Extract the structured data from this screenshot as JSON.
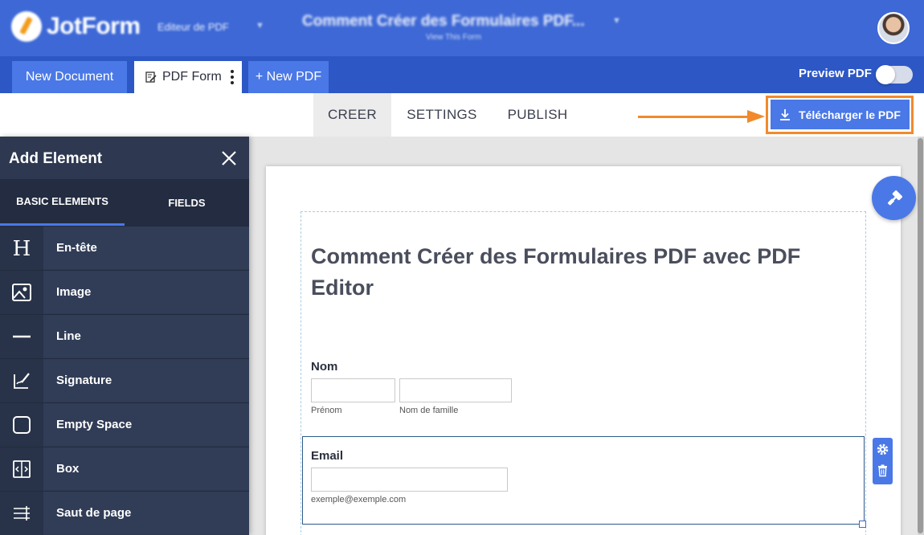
{
  "header": {
    "logo_text": "JotForm",
    "editor_name": "Editeur de PDF",
    "document_title": "Comment Créer des Formulaires PDF...",
    "document_subtitle": "View This Form"
  },
  "tabs": {
    "new_document": "New Document",
    "pdf_form": "PDF Form",
    "new_pdf": "+ New PDF",
    "preview_label": "Preview PDF",
    "preview_on": false
  },
  "subnav": {
    "creer": "CREER",
    "settings": "SETTINGS",
    "publish": "PUBLISH",
    "download": "Télécharger le PDF"
  },
  "panel": {
    "title": "Add Element",
    "tabs": [
      "BASIC ELEMENTS",
      "FIELDS"
    ],
    "items": [
      {
        "label": "En-tête",
        "icon": "heading-icon"
      },
      {
        "label": "Image",
        "icon": "image-icon"
      },
      {
        "label": "Line",
        "icon": "line-icon"
      },
      {
        "label": "Signature",
        "icon": "signature-icon"
      },
      {
        "label": "Empty Space",
        "icon": "empty-space-icon"
      },
      {
        "label": "Box",
        "icon": "box-icon"
      },
      {
        "label": "Saut de page",
        "icon": "page-break-icon"
      }
    ]
  },
  "form": {
    "heading": "Comment Créer des Formulaires PDF avec PDF Editor",
    "name_label": "Nom",
    "first_name_sublabel": "Prénom",
    "last_name_sublabel": "Nom de famille",
    "email_label": "Email",
    "email_sublabel": "exemple@exemple.com"
  },
  "colors": {
    "header_bg": "#3d68d6",
    "tabbar_bg": "#2d57c5",
    "accent": "#4a78e6",
    "highlight": "#f18a2c",
    "panel_bg": "#2e3951"
  }
}
